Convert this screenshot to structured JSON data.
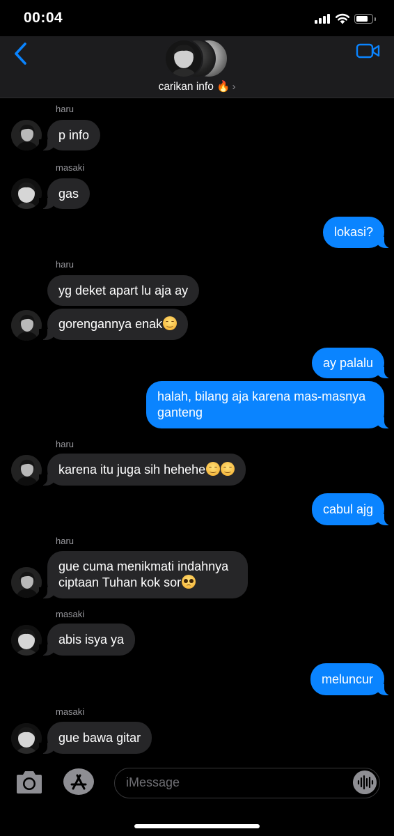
{
  "status_bar": {
    "time": "00:04",
    "battery_percent": 60
  },
  "header": {
    "group_name": "carikan info 🔥",
    "chevron": "›"
  },
  "messages": [
    {
      "sender": "haru",
      "text": "p info",
      "direction": "in"
    },
    {
      "sender": "masaki",
      "text": "gas",
      "direction": "in"
    },
    {
      "text": "lokasi?",
      "direction": "out"
    },
    {
      "sender": "haru",
      "text": "yg deket apart lu aja ay",
      "direction": "in"
    },
    {
      "text": "gorengannya enak",
      "emoji": [
        "smiling-face-icon"
      ],
      "direction": "in"
    },
    {
      "text": "ay palalu",
      "direction": "out"
    },
    {
      "text": "halah, bilang aja karena mas-masnya ganteng",
      "direction": "out"
    },
    {
      "sender": "haru",
      "text": "karena itu juga sih hehehe",
      "emoji": [
        "smiling-face-icon",
        "smiling-face-icon"
      ],
      "direction": "in"
    },
    {
      "text": "cabul ajg",
      "direction": "out"
    },
    {
      "sender": "haru",
      "text": "gue cuma menikmati indahnya ciptaan Tuhan kok sor",
      "emoji": [
        "pleading-face-icon"
      ],
      "direction": "in"
    },
    {
      "sender": "masaki",
      "text": "abis isya ya",
      "direction": "in"
    },
    {
      "text": "meluncur",
      "direction": "out"
    },
    {
      "sender": "masaki",
      "text": "gue bawa gitar",
      "direction": "in"
    }
  ],
  "input": {
    "placeholder": "iMessage"
  },
  "colors": {
    "outgoing_bubble": "#0a84ff",
    "incoming_bubble": "#262628",
    "background": "#000000"
  },
  "icons": [
    "back-chevron-icon",
    "video-camera-icon",
    "camera-icon",
    "app-store-icon",
    "audio-waveform-icon"
  ]
}
